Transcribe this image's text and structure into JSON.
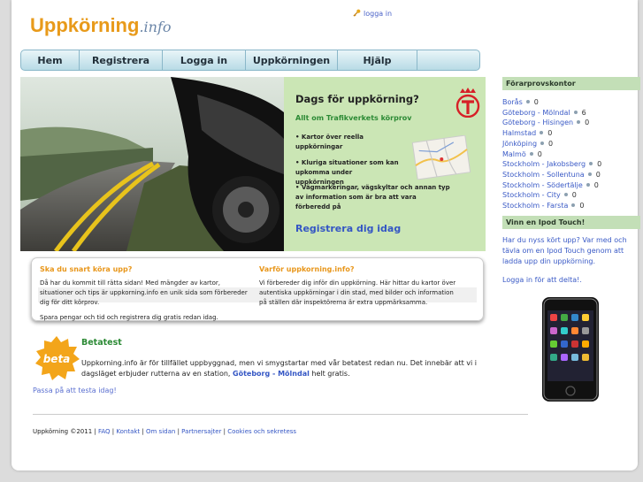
{
  "brand": {
    "name": "Uppkörning",
    "suffix": ".info"
  },
  "header": {
    "login_label": "logga in"
  },
  "nav": {
    "tabs": [
      "Hem",
      "Registrera",
      "Logga in",
      "Uppkörningen",
      "Hjälp",
      ""
    ]
  },
  "hero": {
    "title": "Dags för uppkörning?",
    "subtitle": "Allt om Trafikverkets körprov",
    "bullets": [
      "• Kartor över reella uppkörningar",
      "• Kluriga situationer som kan upkomma under uppkörningen",
      "• Vägmarkeringar, vägskyltar och annan typ av information som är bra att vara förberedd på"
    ],
    "register_label": "Registrera dig idag"
  },
  "info": {
    "left_title": "Ska du snart köra upp?",
    "left_p1": "Då har du kommit till rätta sidan! Med mängder av kartor, situationer och tips är uppkorning.info en unik sida som förbereder dig för ditt körprov.",
    "left_p2": "Spara pengar och tid och registrera dig gratis redan idag.",
    "right_title": "Varför uppkorning.info?",
    "right_p1": "Vi förbereder dig inför din uppkörning. Här hittar du kartor över autentiska uppkörningar i din stad, med bilder och information på ställen där inspektörerna är extra uppmärksamma."
  },
  "beta": {
    "badge": "beta",
    "title": "Betatest",
    "text_before": "Uppkorning.info är för tillfället uppbyggnad, men vi smygstartar med vår betatest redan nu. Det innebär att vi i dagsläget erbjuder rutterna av en station,",
    "text_link": "Göteborg - Mölndal",
    "text_after": "helt gratis.",
    "try_label": "Passa på att testa idag!"
  },
  "footer": {
    "copyright": "Uppkörning ©2011 |",
    "links": [
      "FAQ",
      "Kontakt",
      "Om sidan",
      "Partnersajter",
      "Cookies och sekretess"
    ],
    "sep": "|"
  },
  "sidebar": {
    "offices_title": "Förarprovskontor",
    "offices": [
      {
        "name": "Borås",
        "count": "0"
      },
      {
        "name": "Göteborg - Mölndal",
        "count": "6"
      },
      {
        "name": "Göteborg - Hisingen",
        "count": "0"
      },
      {
        "name": "Halmstad",
        "count": "0"
      },
      {
        "name": "Jönköping",
        "count": "0"
      },
      {
        "name": "Malmö",
        "count": "0"
      },
      {
        "name": "Stockholm - Jakobsberg",
        "count": "0"
      },
      {
        "name": "Stockholm - Sollentuna",
        "count": "0"
      },
      {
        "name": "Stockholm - Södertälje",
        "count": "0"
      },
      {
        "name": "Stockholm - City",
        "count": "0"
      },
      {
        "name": "Stockholm - Farsta",
        "count": "0"
      }
    ],
    "promo_title": "Vinn en Ipod Touch!",
    "promo_text": "Har du nyss kört upp? Var med och tävla om en Ipod Touch genom att ladda upp din uppkörning.",
    "promo_link": "Logga in för att delta!."
  },
  "colors": {
    "brand": "#e89a1a",
    "green": "#2c8a35",
    "link": "#3456c4",
    "hero_bg": "#cbe6b5",
    "nav_border": "#8ab7c9"
  },
  "icons": [
    "key-icon",
    "crown-logo-icon",
    "map-thumbnail",
    "road-photo",
    "beta-badge-icon",
    "ipod-image"
  ]
}
